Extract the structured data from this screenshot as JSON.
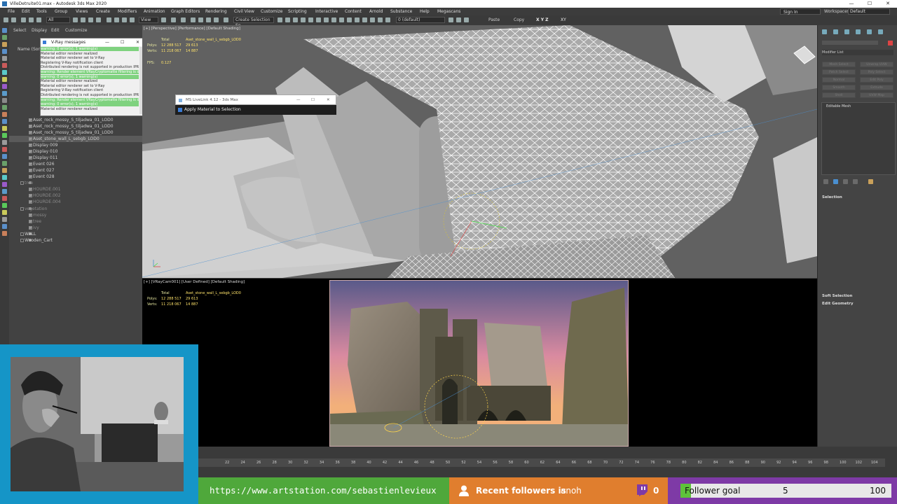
{
  "window": {
    "title": "VilleDetruite01.max - Autodesk 3ds Max 2020",
    "min": "—",
    "max": "☐",
    "close": "✕"
  },
  "menubar": {
    "items": [
      "File",
      "Edit",
      "Tools",
      "Group",
      "Views",
      "Create",
      "Modifiers",
      "Animation",
      "Graph Editors",
      "Rendering",
      "Civil View",
      "Customize",
      "Scripting",
      "Interactive",
      "Content",
      "Arnold",
      "Substance",
      "Help",
      "Megascans"
    ],
    "sign_in": "Sign In",
    "workspaces_label": "Workspaces:",
    "workspace_value": "Default"
  },
  "toolbar": {
    "filter_value": "All",
    "view_value": "View",
    "selection_set": "Create Selection Se",
    "layer_value": "0 (default)",
    "paste": "Paste",
    "copy": "Copy",
    "axes": "X Y Z",
    "xy": "XY"
  },
  "scene_explorer": {
    "tabs": [
      "Select",
      "Display",
      "Edit",
      "Customize"
    ],
    "header": "Name (Sorted Ascending)",
    "rows": [
      "Aset_rock_mossy_S_tiljadwa_01_LOD0",
      "Aset_rock_mossy_S_tiljadwa_01_LOD0",
      "Aset_rock_mossy_S_tiljadwa_01_LOD0",
      "Aset_stone_wall_L_sebgb_LOD0",
      "Display 009",
      "Display 010",
      "Display 011",
      "Event 026",
      "Event 027",
      "Event 028",
      "tree",
      "HOURDE.001",
      "HOURDE.002",
      "HOURDE.004",
      "vegetation",
      "mossy",
      "tree",
      "ivy",
      "WALL",
      "Wooden_Cart"
    ]
  },
  "vray_messages": {
    "title": "V-Ray messages",
    "lines": [
      {
        "text": "warning: 0 error(s), 1 warning(s)",
        "hl": true
      },
      {
        "text": "Material editor renderer realized",
        "hl": false
      },
      {
        "text": "Material editor renderer set to V-Ray",
        "hl": false
      },
      {
        "text": "Registering V-Ray notification client",
        "hl": false
      },
      {
        "text": "Distributed rendering is not supported in production IPR mode",
        "hl": false
      },
      {
        "text": "warning: Render element VRayCryptomatte filtering is disabled",
        "hl": true
      },
      {
        "text": "warning: 0 error(s), 1 warning(s)",
        "hl": true
      },
      {
        "text": "Material editor renderer realized",
        "hl": false
      },
      {
        "text": "Material editor renderer set to V-Ray",
        "hl": false
      },
      {
        "text": "Registering V-Ray notification client",
        "hl": false
      },
      {
        "text": "Distributed rendering is not supported in production IPR mode",
        "hl": false
      },
      {
        "text": "warning: Render element VRayCryptomatte filtering is disabled",
        "hl": true
      },
      {
        "text": "warning: 0 error(s), 1 warning(s)",
        "hl": true
      },
      {
        "text": "Material editor renderer realized",
        "hl": false
      }
    ]
  },
  "viewport_top": {
    "label": "[+] [Perspective] [Performance] [Default Shading]",
    "total_label": "Total",
    "object_name": "Aset_stone_wall_L_sebgb_LOD0",
    "polys_label": "Polys:",
    "polys_total": "12 288 517",
    "polys_obj": "29 613",
    "verts_label": "Verts:",
    "verts_total": "11 218 067",
    "verts_obj": "14 887",
    "fps_label": "FPS:",
    "fps_value": "0.127"
  },
  "viewport_bottom": {
    "label": "[+] [VRayCam001] [User Defined] [Default Shading]",
    "total_label": "Total",
    "object_name": "Aset_stone_wall_L_sebgb_LOD0",
    "polys_label": "Polys:",
    "polys_total": "12 288 517",
    "polys_obj": "29 613",
    "verts_label": "Verts:",
    "verts_total": "11 218 067",
    "verts_obj": "14 887"
  },
  "mslivelink": {
    "title": "MS LiveLink 4.12 - 3ds Max",
    "action": "Apply Material to Selection"
  },
  "command_panel": {
    "modifier_list": "Modifier List",
    "buttons": [
      "Mesh Select",
      "Unwrap UVW",
      "Patch Select",
      "Poly Select",
      "Normal",
      "Edit Poly",
      "Smooth",
      "Extrude",
      "Shell",
      "UVW Map"
    ],
    "stack_item": "Editable Mesh",
    "rollouts": [
      "Selection",
      "Soft Selection",
      "Edit Geometry"
    ]
  },
  "timeline": {
    "ticks": [
      "22",
      "24",
      "26",
      "28",
      "30",
      "32",
      "34",
      "36",
      "38",
      "40",
      "42",
      "44",
      "46",
      "48",
      "50",
      "52",
      "54",
      "56",
      "58",
      "60",
      "62",
      "64",
      "66",
      "68",
      "70",
      "72",
      "74",
      "76",
      "78",
      "80",
      "82",
      "84",
      "86",
      "88",
      "90",
      "92",
      "94",
      "96",
      "98",
      "100",
      "102",
      "104"
    ]
  },
  "stream": {
    "link": "https://www.artstation.com/sebastienlevieux",
    "followers_label": "Recent followers is",
    "followers_name": "anoh",
    "followers_count": "0",
    "goal_label": "Follower goal",
    "goal_current": "5",
    "goal_target": "100",
    "goal_progress": 0.05
  },
  "colors": {
    "webcam_frame": "#1595c7",
    "link_bar": "#4fa83b",
    "followers_bar": "#e07e2e",
    "goal_bar": "#7e3aa6",
    "goal_fill": "#5ec23a",
    "vray_highlight": "#7fd27f"
  }
}
